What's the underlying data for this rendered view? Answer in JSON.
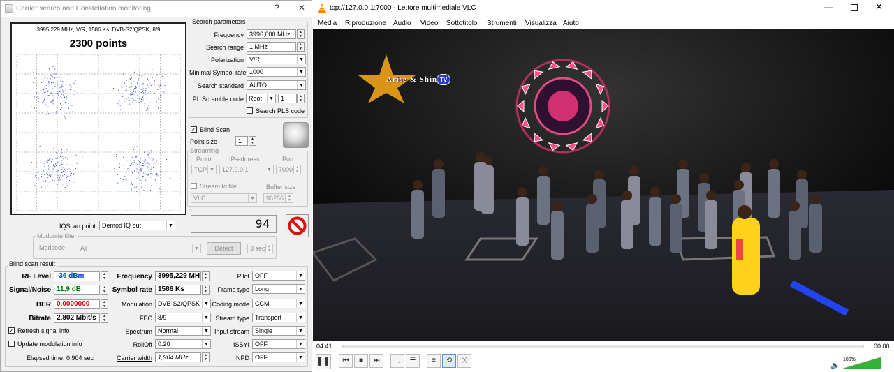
{
  "left_window": {
    "title": "Carrier search and Constellation monitoring",
    "help_label": "?",
    "close_label": "✕",
    "constellation": {
      "info": "3995,229 MHz, V/R, 1586 Ks, DVB-S2/QPSK, 8/9",
      "points": "2300 points"
    },
    "search_params": {
      "title": "Search parameters",
      "frequency_label": "Frequency",
      "frequency_value": "3996,000 MHz",
      "search_range_label": "Search range",
      "search_range_value": "1 MHz",
      "polarization_label": "Polarization",
      "polarization_value": "V/R",
      "min_symbol_rate_label": "Minimal Symbol rate",
      "min_symbol_rate_value": "1000",
      "search_standard_label": "Search standard",
      "search_standard_value": "AUTO",
      "pl_scramble_label": "PL Scramble code",
      "pl_scramble_value": "Root",
      "pl_scramble_num": "1",
      "search_pls_label": "Search PLS code"
    },
    "blind_scan_label": "Blind Scan",
    "point_size_label": "Point size",
    "point_size_value": "1",
    "streaming": {
      "title": "Streaming",
      "proto_label": "Proto",
      "proto_value": "TCP",
      "ip_label": "IP-address",
      "ip_value": "127.0.0.1",
      "port_label": "Port",
      "port_value": "7000",
      "stream_to_file_label": "Stream to file",
      "buffer_size_label": "Buffer size",
      "buffer_size_value": "96256",
      "vlc_value": "VLC"
    },
    "counter_value": "94",
    "iqscan_label": "IQScan point",
    "iqscan_value": "Demod IQ out",
    "modcode": {
      "title": "Modcode filter",
      "label": "Modcode",
      "value": "All",
      "detect_label": "Detect",
      "sec_value": "3 sec"
    },
    "blind_result": {
      "title": "Blind scan result",
      "rf_level_label": "RF Level",
      "rf_level_value": "-36 dBm",
      "snr_label": "Signal/Noise",
      "snr_value": "11,9 dB",
      "ber_label": "BER",
      "ber_value": "0,0000000",
      "bitrate_label": "Bitrate",
      "bitrate_value": "2,802 Mbit/s",
      "frequency_label": "Frequency",
      "frequency_value": "3995,229 MHz",
      "symbol_rate_label": "Symbol rate",
      "symbol_rate_value": "1586 Ks",
      "modulation_label": "Modulation",
      "modulation_value": "DVB-S2/QPSK",
      "fec_label": "FEC",
      "fec_value": "8/9",
      "spectrum_label": "Spectrum",
      "spectrum_value": "Normal",
      "rolloff_label": "RollOff",
      "rolloff_value": "0.20",
      "carrier_width_label": "Carrier width",
      "carrier_width_value": "1,904 MHz",
      "pilot_label": "Pilot",
      "pilot_value": "OFF",
      "frame_type_label": "Frame type",
      "frame_type_value": "Long",
      "coding_mode_label": "Coding mode",
      "coding_mode_value": "CCM",
      "stream_type_label": "Stream type",
      "stream_type_value": "Transport",
      "input_stream_label": "Input stream",
      "input_stream_value": "Single",
      "issyi_label": "ISSYI",
      "issyi_value": "OFF",
      "npd_label": "NPD",
      "npd_value": "OFF"
    },
    "refresh_signal_label": "Refresh signal info",
    "update_modulation_label": "Update modulation info",
    "elapsed_time": "Elapsed time: 0.904 sec"
  },
  "vlc": {
    "title": "tcp://127.0.0.1:7000 - Lettore multimediale VLC",
    "menu": [
      "Media",
      "Riproduzione",
      "Audio",
      "Video",
      "Sottotitolo",
      "Strumenti",
      "Visualizza",
      "Aiuto"
    ],
    "time_elapsed": "04:41",
    "time_total": "00:00",
    "volume": "100%",
    "volume_level": 1.0,
    "channel_logo": "Arise & Shine",
    "channel_logo_badge": "TV"
  },
  "colors": {
    "vlc_accent": "#ff8800",
    "ber_red": "#d00000",
    "rf_blue": "#0044cc",
    "snr_green": "#007a00",
    "volume_green": "#34b233",
    "stop_red": "#d11"
  }
}
